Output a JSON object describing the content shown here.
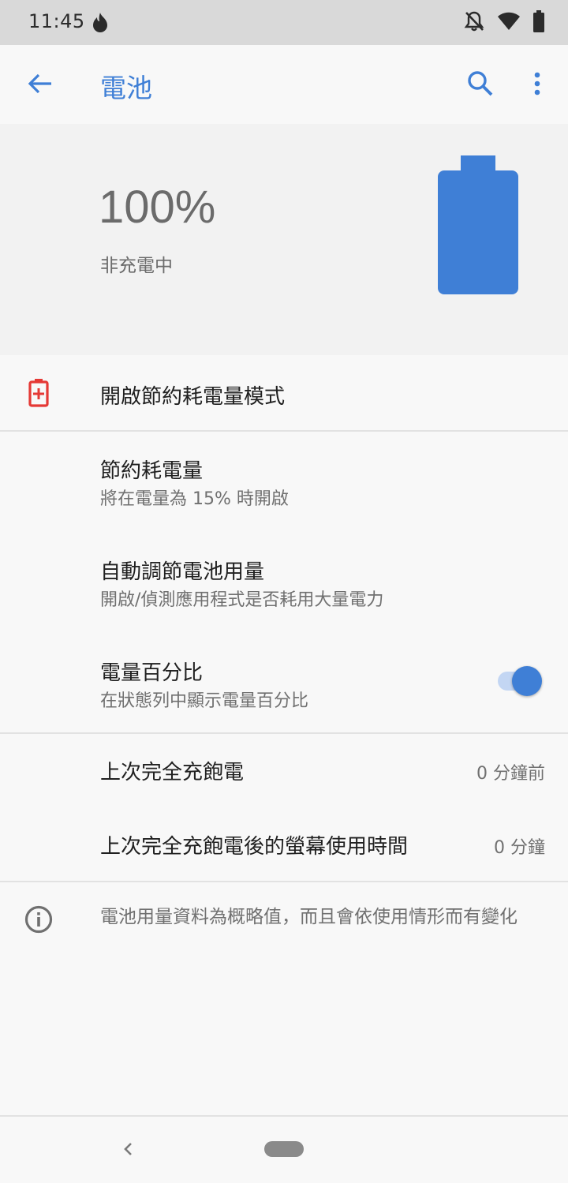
{
  "status_bar": {
    "time": "11:45",
    "icons": [
      "flame-icon",
      "notifications-off-icon",
      "wifi-icon",
      "battery-icon"
    ]
  },
  "app_bar": {
    "title": "電池",
    "back_icon": "arrow-back-icon",
    "search_icon": "search-icon",
    "more_icon": "more-vert-icon"
  },
  "battery": {
    "level_percent_label": "100%",
    "status": "非充電中",
    "level_fraction": 1.0
  },
  "settings": {
    "battery_saver_action": "開啟節約耗電量模式",
    "battery_saver": {
      "title": "節約耗電量",
      "summary": "將在電量為 15% 時開啟"
    },
    "adaptive_battery": {
      "title": "自動調節電池用量",
      "summary": "開啟/偵測應用程式是否耗用大量電力"
    },
    "battery_percentage": {
      "title": "電量百分比",
      "summary": "在狀態列中顯示電量百分比",
      "enabled": true
    },
    "last_full_charge": {
      "title": "上次完全充飽電",
      "value": "0 分鐘前"
    },
    "screen_usage": {
      "title": "上次完全充飽電後的螢幕使用時間",
      "value": "0 分鐘"
    },
    "footer_info": "電池用量資料為概略值，而且會依使用情形而有變化"
  },
  "colors": {
    "accent": "#3f7fd6",
    "saver_icon": "#e53935",
    "status_bar_bg": "#d9d9d9",
    "header_bg": "#f2f2f2",
    "page_bg": "#f8f8f8"
  }
}
